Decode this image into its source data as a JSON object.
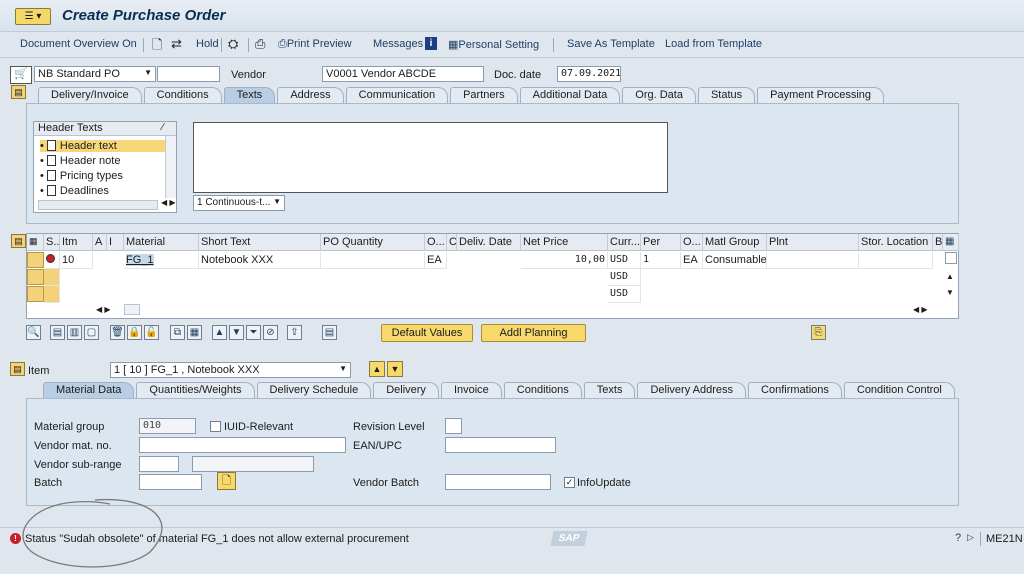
{
  "window": {
    "title": "Create Purchase Order"
  },
  "toolbar": {
    "doc_overview": "Document Overview On",
    "hold": "Hold",
    "print_preview": "Print Preview",
    "messages": "Messages",
    "personal_setting": "Personal Setting",
    "save_template": "Save As Template",
    "load_template": "Load from Template"
  },
  "header": {
    "doc_type": "NB Standard PO",
    "doc_type_extra": "",
    "vendor_label": "Vendor",
    "vendor": "V0001 Vendor ABCDE",
    "doc_date_label": "Doc. date",
    "doc_date": "07.09.2021"
  },
  "header_tabs": [
    "Delivery/Invoice",
    "Conditions",
    "Texts",
    "Address",
    "Communication",
    "Partners",
    "Additional Data",
    "Org. Data",
    "Status",
    "Payment Processing"
  ],
  "header_texts": {
    "title": "Header Texts",
    "items": [
      "Header text",
      "Header note",
      "Pricing types",
      "Deadlines"
    ],
    "view_select": "1 Continuous-t..."
  },
  "grid": {
    "columns": [
      "S..",
      "Itm",
      "A",
      "I",
      "Material",
      "Short Text",
      "PO Quantity",
      "O...",
      "C",
      "Deliv. Date",
      "Net Price",
      "Curr...",
      "Per",
      "O...",
      "Matl Group",
      "Plnt",
      "Stor. Location",
      "B"
    ],
    "rows": [
      {
        "itm": "10",
        "material": "FG_1",
        "short_text": "Notebook XXX",
        "uom": "EA",
        "net_price": "10,00",
        "currency": "USD",
        "per": "1",
        "order_unit": "EA",
        "matl_group": "Consumables"
      },
      {
        "currency": "USD"
      },
      {
        "currency": "USD"
      }
    ]
  },
  "buttons": {
    "default_values": "Default Values",
    "addl_planning": "Addl Planning"
  },
  "item": {
    "label": "Item",
    "selector": "1 [ 10 ] FG_1 , Notebook XXX"
  },
  "item_tabs": [
    "Material Data",
    "Quantities/Weights",
    "Delivery Schedule",
    "Delivery",
    "Invoice",
    "Conditions",
    "Texts",
    "Delivery Address",
    "Confirmations",
    "Condition Control"
  ],
  "material_data": {
    "material_group_label": "Material group",
    "material_group": "010",
    "iuid_label": "IUID-Relevant",
    "revision_label": "Revision Level",
    "vendor_mat_label": "Vendor mat. no.",
    "ean_label": "EAN/UPC",
    "vendor_subrange_label": "Vendor sub-range",
    "batch_label": "Batch",
    "vendor_batch_label": "Vendor Batch",
    "infoupdate_label": "InfoUpdate"
  },
  "status": {
    "message": "Status \"Sudah obsolete\" of material FG_1 does not allow external procurement",
    "transaction": "ME21N",
    "logo": "SAP"
  },
  "colors": {
    "accent": "#f7d86b",
    "title": "#0b2d52",
    "error": "#c8202a"
  }
}
